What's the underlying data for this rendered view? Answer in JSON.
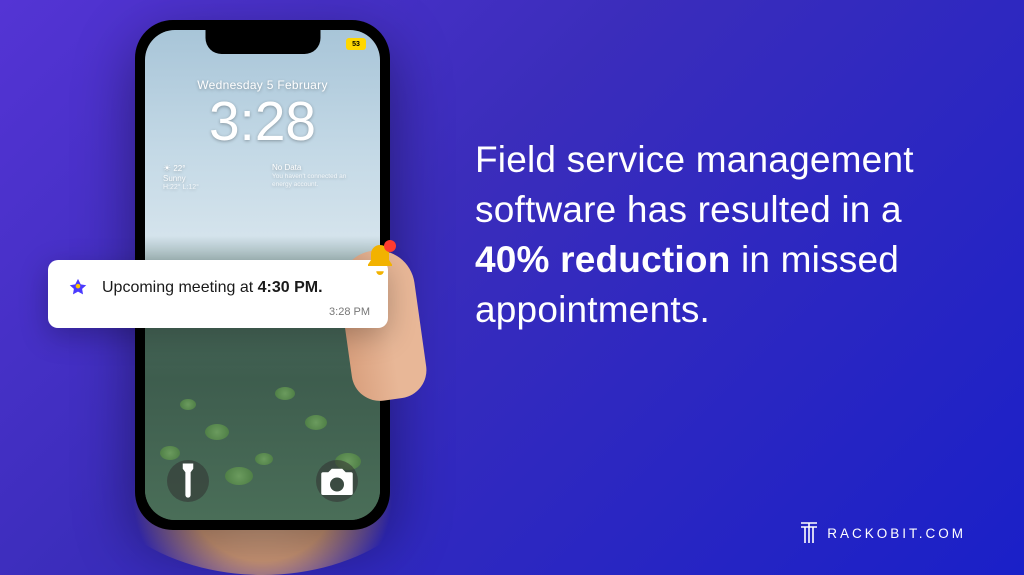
{
  "phone": {
    "battery_label": "53",
    "date": "Wednesday 5 February",
    "time": "3:28",
    "weather": {
      "temp": "22°",
      "condition": "Sunny",
      "hilow": "H:22° L:12°",
      "nodata_title": "No Data",
      "nodata_sub": "You haven't connected an energy account."
    }
  },
  "notification": {
    "text_prefix": "Upcoming meeting at ",
    "text_bold": "4:30 PM.",
    "time": "3:28 PM"
  },
  "headline": {
    "part1": "Field service management software has resulted in a ",
    "bold": "40% reduction",
    "part2": " in missed appointments."
  },
  "brand": {
    "text": "rackobit.com"
  }
}
